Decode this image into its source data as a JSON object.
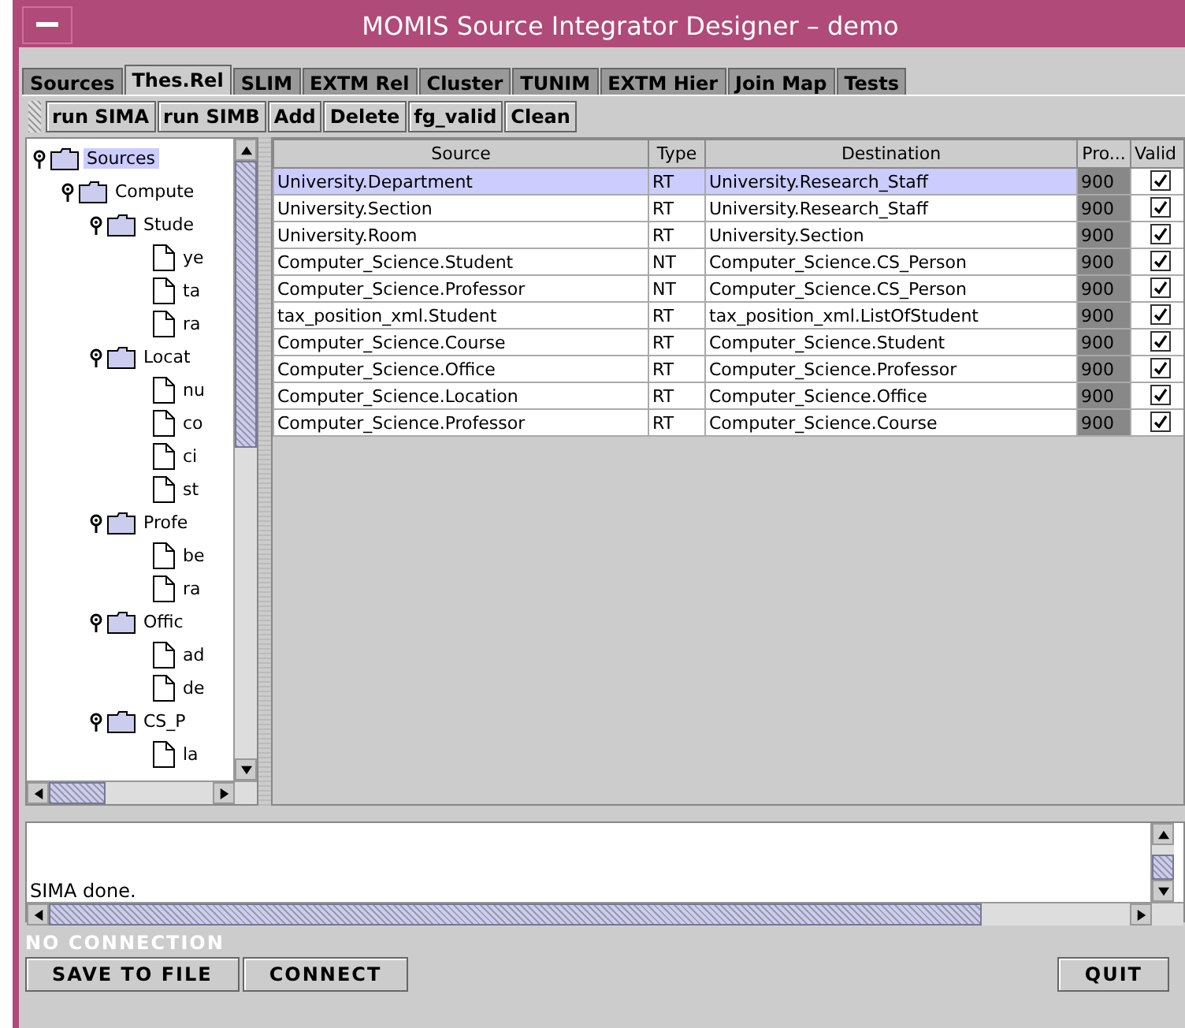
{
  "window": {
    "title": "MOMIS Source Integrator Designer – demo"
  },
  "tabs": [
    {
      "label": "Sources",
      "selected": false
    },
    {
      "label": "Thes.Rel",
      "selected": true
    },
    {
      "label": "SLIM",
      "selected": false
    },
    {
      "label": "EXTM Rel",
      "selected": false
    },
    {
      "label": "Cluster",
      "selected": false
    },
    {
      "label": "TUNIM",
      "selected": false
    },
    {
      "label": "EXTM Hier",
      "selected": false
    },
    {
      "label": "Join Map",
      "selected": false
    },
    {
      "label": "Tests",
      "selected": false
    }
  ],
  "toolbar": [
    "run SIMA",
    "run SIMB",
    "Add",
    "Delete",
    "fg_valid",
    "Clean"
  ],
  "tree": [
    {
      "label": "Sources",
      "kind": "folder",
      "selected": true,
      "expanded": true,
      "children": [
        {
          "label": "Compute",
          "kind": "folder",
          "selected": false,
          "expanded": true,
          "children": [
            {
              "label": "Stude",
              "kind": "folder",
              "selected": false,
              "expanded": true,
              "children": [
                {
                  "label": "ye",
                  "kind": "leaf",
                  "selected": false
                },
                {
                  "label": "ta",
                  "kind": "leaf",
                  "selected": false
                },
                {
                  "label": "ra",
                  "kind": "leaf",
                  "selected": false
                }
              ]
            },
            {
              "label": "Locat",
              "kind": "folder",
              "selected": false,
              "expanded": true,
              "children": [
                {
                  "label": "nu",
                  "kind": "leaf",
                  "selected": false
                },
                {
                  "label": "co",
                  "kind": "leaf",
                  "selected": false
                },
                {
                  "label": "ci",
                  "kind": "leaf",
                  "selected": false
                },
                {
                  "label": "st",
                  "kind": "leaf",
                  "selected": false
                }
              ]
            },
            {
              "label": "Profe",
              "kind": "folder",
              "selected": false,
              "expanded": true,
              "children": [
                {
                  "label": "be",
                  "kind": "leaf",
                  "selected": false
                },
                {
                  "label": "ra",
                  "kind": "leaf",
                  "selected": false
                }
              ]
            },
            {
              "label": "Offic",
              "kind": "folder",
              "selected": false,
              "expanded": true,
              "children": [
                {
                  "label": "ad",
                  "kind": "leaf",
                  "selected": false
                },
                {
                  "label": "de",
                  "kind": "leaf",
                  "selected": false
                }
              ]
            },
            {
              "label": "CS_P",
              "kind": "folder",
              "selected": false,
              "expanded": true,
              "children": [
                {
                  "label": "la",
                  "kind": "leaf",
                  "selected": false
                }
              ]
            }
          ]
        }
      ]
    }
  ],
  "table": {
    "columns": [
      "Source",
      "Type",
      "Destination",
      "Pro...",
      "Valid"
    ],
    "rows": [
      {
        "source": "University.Department",
        "type": "RT",
        "destination": "University.Research_Staff",
        "pro": "900",
        "valid": true,
        "selected": true
      },
      {
        "source": "University.Section",
        "type": "RT",
        "destination": "University.Research_Staff",
        "pro": "900",
        "valid": true,
        "selected": false
      },
      {
        "source": "University.Room",
        "type": "RT",
        "destination": "University.Section",
        "pro": "900",
        "valid": true,
        "selected": false
      },
      {
        "source": "Computer_Science.Student",
        "type": "NT",
        "destination": "Computer_Science.CS_Person",
        "pro": "900",
        "valid": true,
        "selected": false
      },
      {
        "source": "Computer_Science.Professor",
        "type": "NT",
        "destination": "Computer_Science.CS_Person",
        "pro": "900",
        "valid": true,
        "selected": false
      },
      {
        "source": "tax_position_xml.Student",
        "type": "RT",
        "destination": "tax_position_xml.ListOfStudent",
        "pro": "900",
        "valid": true,
        "selected": false
      },
      {
        "source": "Computer_Science.Course",
        "type": "RT",
        "destination": "Computer_Science.Student",
        "pro": "900",
        "valid": true,
        "selected": false
      },
      {
        "source": "Computer_Science.Office",
        "type": "RT",
        "destination": "Computer_Science.Professor",
        "pro": "900",
        "valid": true,
        "selected": false
      },
      {
        "source": "Computer_Science.Location",
        "type": "RT",
        "destination": "Computer_Science.Office",
        "pro": "900",
        "valid": true,
        "selected": false
      },
      {
        "source": "Computer_Science.Professor",
        "type": "RT",
        "destination": "Computer_Science.Course",
        "pro": "900",
        "valid": true,
        "selected": false
      }
    ]
  },
  "log": {
    "text": "SIMA done."
  },
  "status_bar": {
    "text": "NO CONNECTION"
  },
  "buttons": [
    "SAVE TO FILE",
    "CONNECT",
    "QUIT"
  ]
}
